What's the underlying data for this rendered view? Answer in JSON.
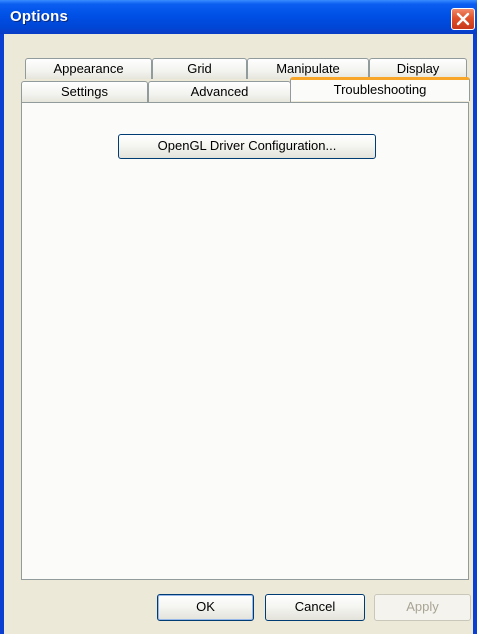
{
  "window": {
    "title": "Options"
  },
  "tabs": {
    "row_top": [
      {
        "label": "Appearance"
      },
      {
        "label": "Grid"
      },
      {
        "label": "Manipulate"
      },
      {
        "label": "Display"
      }
    ],
    "row_bottom": [
      {
        "label": "Settings"
      },
      {
        "label": "Advanced"
      },
      {
        "label": "Troubleshooting",
        "active": true
      }
    ]
  },
  "panel": {
    "opengl_button_label": "OpenGL Driver Configuration..."
  },
  "footer": {
    "ok_label": "OK",
    "cancel_label": "Cancel",
    "apply_label": "Apply"
  },
  "colors": {
    "title_bar": "#0050e6",
    "active_tab_accent": "#f7a628",
    "dialog_face": "#ece9d8"
  },
  "icons": {
    "close": "close-icon"
  }
}
